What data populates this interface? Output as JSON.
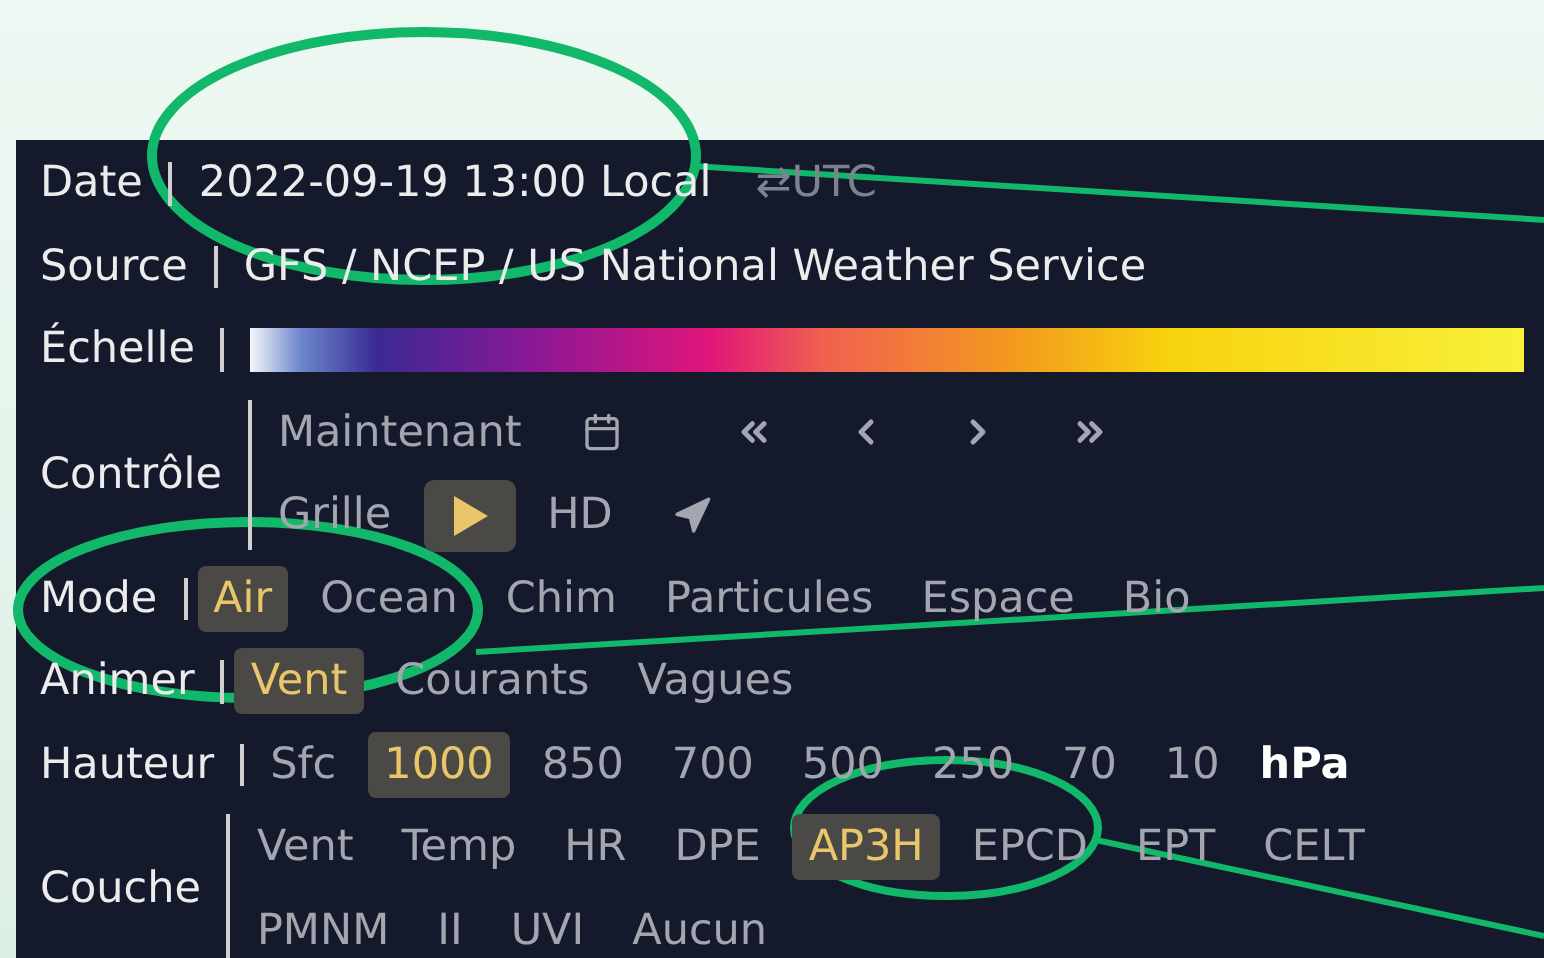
{
  "rows": [
    {
      "kind": "date",
      "label": "Date",
      "value": "2022-09-19 13:00 Local",
      "toggle": "⇄UTC"
    },
    {
      "kind": "text",
      "label": "Source",
      "value": "GFS / NCEP / US National Weather Service"
    },
    {
      "kind": "scale",
      "label": "Échelle"
    },
    {
      "kind": "control",
      "label": "Contrôle",
      "now": "Maintenant",
      "grid": "Grille",
      "hd": "HD",
      "play_selected": true
    },
    {
      "kind": "options",
      "label": "Mode",
      "lines": [
        [
          {
            "label": "Air",
            "selected": true
          },
          {
            "label": "Ocean",
            "selected": false
          },
          {
            "label": "Chim",
            "selected": false
          },
          {
            "label": "Particules",
            "selected": false
          },
          {
            "label": "Espace",
            "selected": false
          },
          {
            "label": "Bio",
            "selected": false
          }
        ]
      ]
    },
    {
      "kind": "options",
      "label": "Animer",
      "lines": [
        [
          {
            "label": "Vent",
            "selected": true
          },
          {
            "label": "Courants",
            "selected": false
          },
          {
            "label": "Vagues",
            "selected": false
          }
        ]
      ]
    },
    {
      "kind": "options",
      "label": "Hauteur",
      "unit": "hPa",
      "lines": [
        [
          {
            "label": "Sfc",
            "selected": false
          },
          {
            "label": "1000",
            "selected": true
          },
          {
            "label": "850",
            "selected": false
          },
          {
            "label": "700",
            "selected": false
          },
          {
            "label": "500",
            "selected": false
          },
          {
            "label": "250",
            "selected": false
          },
          {
            "label": "70",
            "selected": false
          },
          {
            "label": "10",
            "selected": false
          }
        ]
      ]
    },
    {
      "kind": "options",
      "label": "Couche",
      "lines": [
        [
          {
            "label": "Vent",
            "selected": false
          },
          {
            "label": "Temp",
            "selected": false
          },
          {
            "label": "HR",
            "selected": false
          },
          {
            "label": "DPE",
            "selected": false
          },
          {
            "label": "AP3H",
            "selected": true
          },
          {
            "label": "EPCD",
            "selected": false
          },
          {
            "label": "EPT",
            "selected": false
          },
          {
            "label": "CELT",
            "selected": false
          }
        ],
        [
          {
            "label": "PMNM",
            "selected": false
          },
          {
            "label": "II",
            "selected": false
          },
          {
            "label": "UVI",
            "selected": false
          },
          {
            "label": "Aucun",
            "selected": false
          }
        ]
      ]
    }
  ]
}
